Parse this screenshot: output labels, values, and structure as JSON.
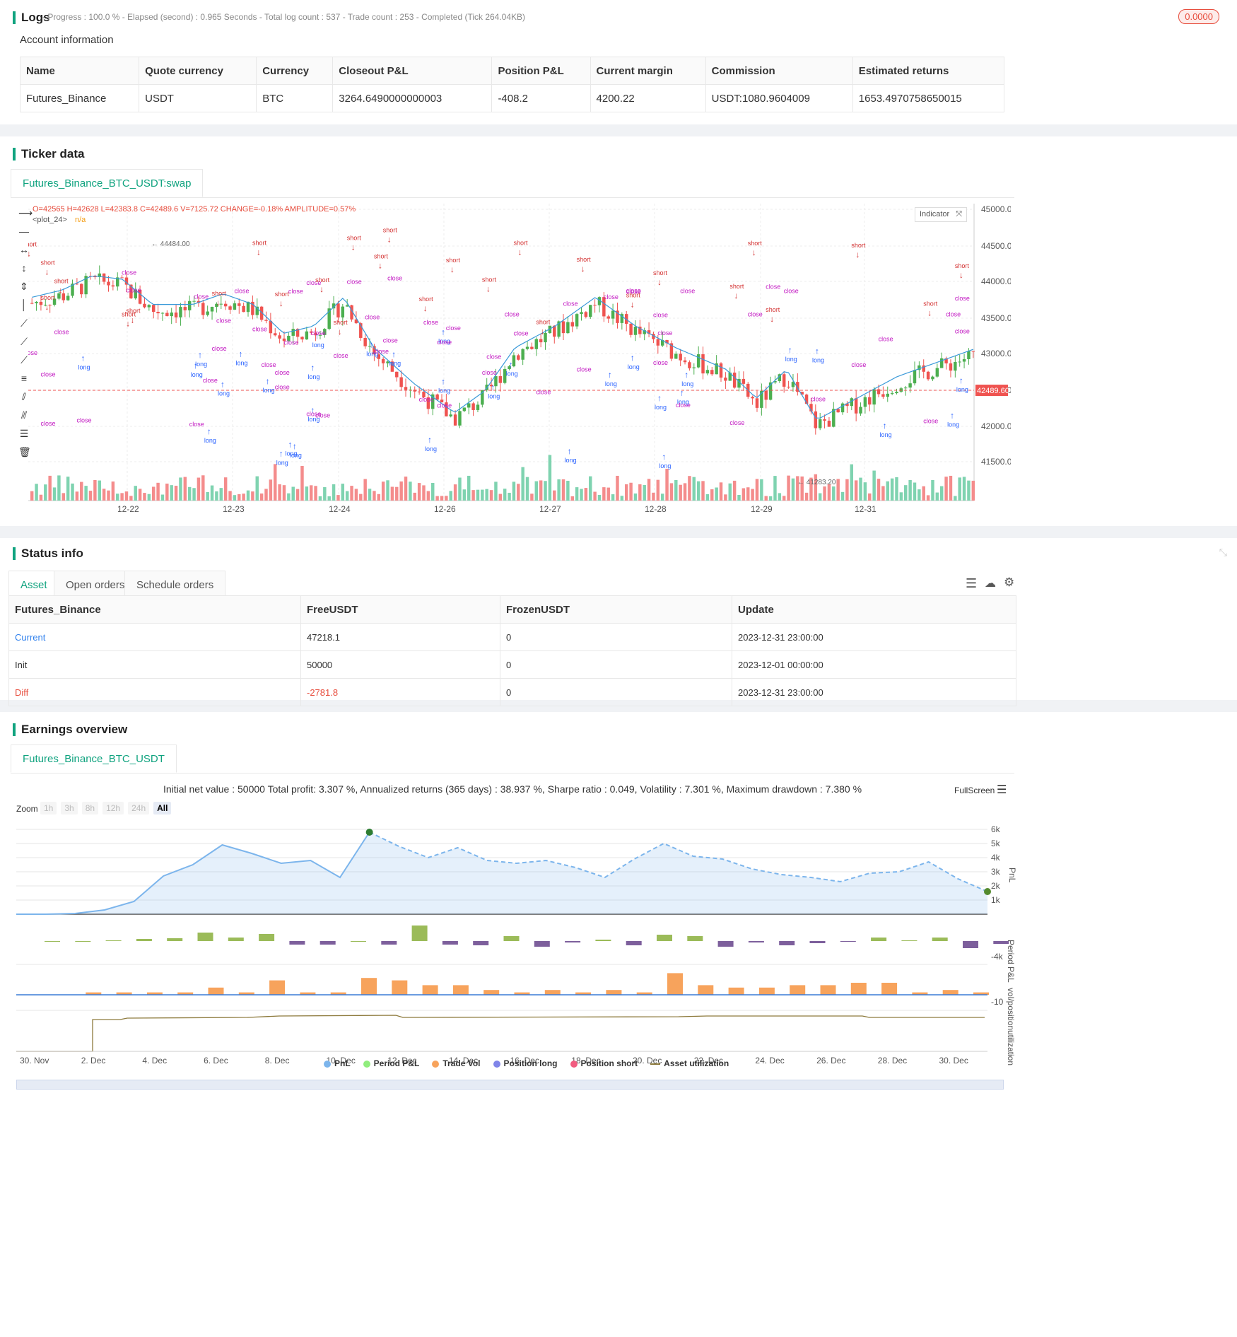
{
  "logs": {
    "title": "Logs",
    "status": "- Progress : 100.0 % - Elapsed (second) : 0.965 Seconds - Total log count : 537 - Trade count : 253 - Completed (Tick 264.04KB)",
    "badge": "0.0000"
  },
  "account": {
    "title": "Account information",
    "headers": [
      "Name",
      "Quote currency",
      "Currency",
      "Closeout P&L",
      "Position P&L",
      "Current margin",
      "Commission",
      "Estimated returns"
    ],
    "row": [
      "Futures_Binance",
      "USDT",
      "BTC",
      "3264.6490000000003",
      "-408.2",
      "4200.22",
      "USDT:1080.9604009",
      "1653.4970758650015"
    ]
  },
  "ticker": {
    "title": "Ticker data",
    "tab": "Futures_Binance_BTC_USDT:swap",
    "ohlc": "O=42565 H=42628 L=42383.8 C=42489.6 V=7125.72 CHANGE=-0.18% AMPLITUDE=0.57%",
    "plot_label": "<plot_24>",
    "plot_value": "n/a",
    "indicator_btn": "Indicator",
    "high_marker": "44484.00",
    "low_marker": "41283.20",
    "last_price": "42489.60",
    "y_ticks": [
      "45000.00",
      "44500.00",
      "44000.00",
      "43500.00",
      "43000.00",
      "42500.00",
      "42000.00",
      "41500.00"
    ],
    "x_ticks": [
      "12-22",
      "12-23",
      "12-24",
      "12-26",
      "12-27",
      "12-28",
      "12-29",
      "12-31"
    ]
  },
  "status": {
    "title": "Status info",
    "tabs": [
      "Asset",
      "Open orders",
      "Schedule orders"
    ],
    "headers": [
      "Futures_Binance",
      "FreeUSDT",
      "FrozenUSDT",
      "Update"
    ],
    "rows": [
      [
        "Current",
        "47218.1",
        "0",
        "2023-12-31 23:00:00"
      ],
      [
        "Init",
        "50000",
        "0",
        "2023-12-01 00:00:00"
      ],
      [
        "Diff",
        "-2781.8",
        "0",
        "2023-12-31 23:00:00"
      ]
    ]
  },
  "earnings": {
    "title": "Earnings overview",
    "tab": "Futures_Binance_BTC_USDT",
    "summary": "Initial net value : 50000 Total profit: 3.307 %, Annualized returns (365 days) : 38.937 %, Sharpe ratio : 0.049, Volatility : 7.301 %, Maximum drawdown : 7.380 %",
    "fullscreen": "FullScreen",
    "zoom_label": "Zoom",
    "zoom_options": [
      "1h",
      "3h",
      "8h",
      "12h",
      "24h",
      "All"
    ],
    "y_pnl_ticks": [
      "6k",
      "5k",
      "4k",
      "3k",
      "2k",
      "1k"
    ],
    "axis_labels": [
      "PnL",
      "Period P&L",
      "vol/position",
      "utilization"
    ],
    "small_ticks": [
      "-4k",
      "-10"
    ],
    "x_ticks": [
      "30. Nov",
      "2. Dec",
      "4. Dec",
      "6. Dec",
      "8. Dec",
      "10. Dec",
      "12. Dec",
      "14. Dec",
      "16. Dec",
      "18. Dec",
      "20. Dec",
      "22. Dec",
      "24. Dec",
      "26. Dec",
      "28. Dec",
      "30. Dec"
    ],
    "legend": [
      {
        "name": "PnL",
        "color": "#7cb5ec"
      },
      {
        "name": "Period P&L",
        "color": "#90ed7d"
      },
      {
        "name": "Trade Vol",
        "color": "#f7a35c"
      },
      {
        "name": "Position long",
        "color": "#8085e9"
      },
      {
        "name": "Position short",
        "color": "#f15c80"
      },
      {
        "name": "Asset utilization",
        "color": "#8d7a3c"
      }
    ]
  },
  "chart_data": {
    "type": "line",
    "series": [
      {
        "name": "PnL",
        "values": [
          0,
          0,
          50,
          300,
          900,
          2700,
          3500,
          4900,
          4300,
          3600,
          3800,
          2600,
          5800,
          4800,
          4000,
          4700,
          3800,
          3600,
          3800,
          3300,
          2600,
          3900,
          5000,
          4100,
          3900,
          3200,
          2800,
          2600,
          2300,
          2900,
          3000,
          3700,
          2500,
          1600
        ]
      }
    ],
    "ylim": [
      0,
      6500
    ]
  }
}
